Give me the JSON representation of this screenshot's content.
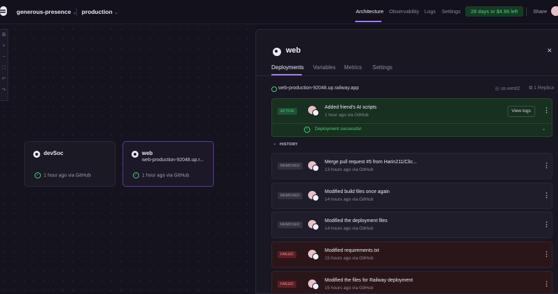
{
  "topbar": {
    "project": "generous-presence",
    "environment": "production",
    "nav": [
      "Architecture",
      "Observability",
      "Logs",
      "Settings"
    ],
    "trial": "28 days or $4.96 left",
    "share": "Share"
  },
  "services": [
    {
      "name": "devSoc",
      "status": "1 hour ago via GitHub"
    },
    {
      "name": "web",
      "url": "web-production-92048.up.r...",
      "status": "1 hour ago via GitHub"
    }
  ],
  "panel": {
    "title": "web",
    "tabs": [
      "Deployments",
      "Variables",
      "Metrics",
      "Settings"
    ],
    "url": "web-production-92048.up.railway.app",
    "region": "us-west2",
    "replicas": "1 Replica",
    "active": {
      "badge": "ACTIVE",
      "message": "Added friend's AI scripts",
      "meta": "1 hour ago via GitHub",
      "view_logs": "View logs",
      "status": "Deployment successful"
    },
    "history_label": "HISTORY",
    "history": [
      {
        "badge": "REMOVED",
        "message": "Merge pull request #5 from Harin211/Clic...",
        "meta": "13 hours ago via GitHub"
      },
      {
        "badge": "REMOVED",
        "message": "Modified build files once again",
        "meta": "14 hours ago via GitHub"
      },
      {
        "badge": "REMOVED",
        "message": "Modified the deployment files",
        "meta": "14 hours ago via GitHub"
      },
      {
        "badge": "FAILED",
        "message": "Modified requirements.txt",
        "meta": "15 hours ago via GitHub"
      },
      {
        "badge": "FAILED",
        "message": "Modified the files for Railway deployment",
        "meta": "15 hours ago via GitHub"
      }
    ]
  },
  "colors": {
    "accent": "#a47cf3",
    "success": "#4ad07e",
    "failed": "#ff8a8a"
  }
}
